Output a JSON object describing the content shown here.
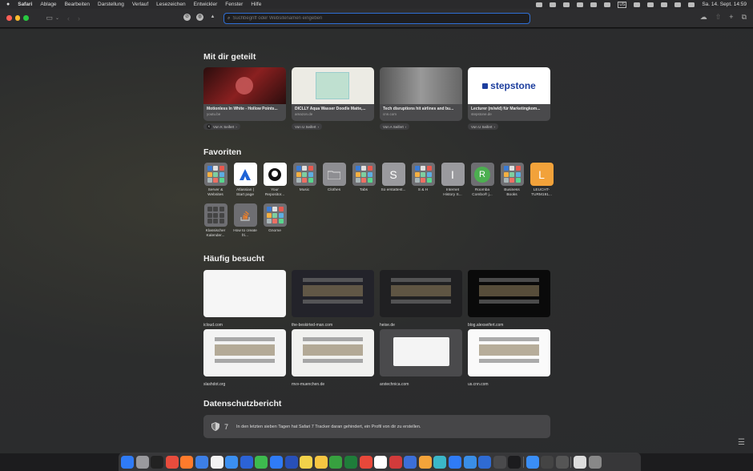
{
  "menubar": {
    "apple": "",
    "items": [
      "Safari",
      "Ablage",
      "Bearbeiten",
      "Darstellung",
      "Verlauf",
      "Lesezeichen",
      "Entwickler",
      "Fenster",
      "Hilfe"
    ],
    "input_source": "US",
    "datetime": "Sa. 14. Sept.  14:59"
  },
  "toolbar": {
    "url_placeholder": "Suchbegriff oder Websitenamen eingeben"
  },
  "shared": {
    "title": "Mit dir geteilt",
    "cards": [
      {
        "title": "Motionless In White - Hollow Points...",
        "url": "youtu.be",
        "from": "Von K Seifert",
        "from_initial": "K",
        "thumb": "#5a1a1a"
      },
      {
        "title": "DICLLY Aqua Wasser Doodle Matte,...",
        "url": "amazon.de",
        "from": "Von U Seifert",
        "from_initial": "U",
        "thumb": "#e9e7de"
      },
      {
        "title": "Tech disruptions hit airlines and bu...",
        "url": "cnn.com",
        "from": "Von A Seifert",
        "from_initial": "A",
        "thumb": "#6a6a6a"
      },
      {
        "title": "Lecturer (m/w/d) für Marketingkom...",
        "url": "stepstone.de",
        "from": "Von U Seifert",
        "from_initial": "U",
        "thumb": "#ffffff",
        "logo": "stepstone"
      }
    ]
  },
  "favorites": {
    "title": "Favoriten",
    "items": [
      {
        "label": "Server & Websites",
        "icon": "folder-grid-icon",
        "color": "#6e6e72"
      },
      {
        "label": "Atlassian | Start page",
        "icon": "atlassian-icon",
        "color": "#ffffff"
      },
      {
        "label": "Your Repositor...",
        "icon": "github-icon",
        "color": "#ffffff"
      },
      {
        "label": "Music",
        "icon": "folder-grid-icon",
        "color": "#6e6e72"
      },
      {
        "label": "Clothes",
        "icon": "folder-icon",
        "color": "#8e8e92"
      },
      {
        "label": "Tabs",
        "icon": "folder-grid-icon",
        "color": "#6e6e72"
      },
      {
        "label": "So erstattest...",
        "icon": "letter-icon",
        "letter": "S",
        "color": "#9a9a9e"
      },
      {
        "label": "S & H",
        "icon": "folder-grid-icon",
        "color": "#6e6e72"
      },
      {
        "label": "Internet History S...",
        "icon": "letter-icon",
        "letter": "I",
        "color": "#9a9a9e"
      },
      {
        "label": "Roomba Combo® j...",
        "icon": "roomba-icon",
        "color": "#6e6e72"
      },
      {
        "label": "Business Books",
        "icon": "folder-grid-icon",
        "color": "#6e6e72"
      },
      {
        "label": "LEUCHT-TURM191...",
        "icon": "letter-icon",
        "letter": "L",
        "color": "#f2a23a"
      },
      {
        "label": "Klassischer Kalender...",
        "icon": "calendar-grid-icon",
        "color": "#6e6e72"
      },
      {
        "label": "How to create fri...",
        "icon": "stackoverflow-icon",
        "color": "#6e6e72"
      },
      {
        "label": "Gnome",
        "icon": "folder-grid-icon",
        "color": "#6e6e72"
      }
    ]
  },
  "frequent": {
    "title": "Häufig besucht",
    "items": [
      {
        "label": "icloud.com",
        "bg": "#f6f6f6"
      },
      {
        "label": "the-beskirted-man.com",
        "bg": "#23232a"
      },
      {
        "label": "heise.de",
        "bg": "#202022"
      },
      {
        "label": "blog.alexseifert.com",
        "bg": "#0a0a0a"
      },
      {
        "label": "slashdot.org",
        "bg": "#f3f3f3"
      },
      {
        "label": "mvv-muenchen.de",
        "bg": "#f1f1ef"
      },
      {
        "label": "arstechnica.com",
        "bg": "#4a4a4c"
      },
      {
        "label": "us.cnn.com",
        "bg": "#fafafa"
      }
    ]
  },
  "privacy": {
    "title": "Datenschutzbericht",
    "count": "7",
    "text": "In den letzten sieben Tagen hat Safari 7 Tracker daran gehindert, ein Profil von dir zu erstellen."
  },
  "dock": {
    "apps": [
      "#2f7bf6",
      "#9a9a9e",
      "#222222",
      "#e84c3d",
      "#ff7b2c",
      "#3d7fe6",
      "#f2f2f2",
      "#3b8ff0",
      "#2c63d6",
      "#3dba4e",
      "#2f7bf6",
      "#2850b8",
      "#f2d24a",
      "#f6c542",
      "#37a13f",
      "#1f7d3a",
      "#e8483a",
      "#ffffff",
      "#d23b3b",
      "#3c6fd8",
      "#f4a43a",
      "#3bb7c8",
      "#2f7bf6",
      "#3a8ee6",
      "#2f6bd3",
      "#4a4a4c",
      "#1c1c1e",
      "#3a8ef6",
      "#444444",
      "#555555",
      "#dddddd",
      "#888888"
    ]
  }
}
